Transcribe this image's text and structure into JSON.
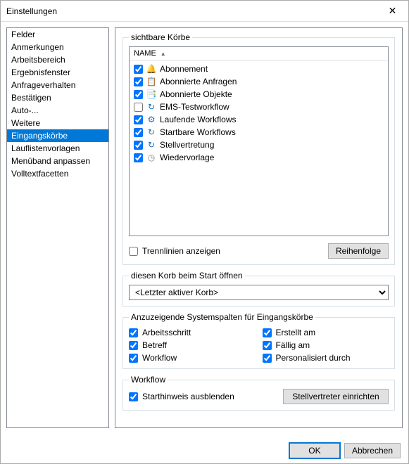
{
  "window": {
    "title": "Einstellungen"
  },
  "sidebar": {
    "items": [
      {
        "label": "Felder"
      },
      {
        "label": "Anmerkungen"
      },
      {
        "label": "Arbeitsbereich"
      },
      {
        "label": "Ergebnisfenster"
      },
      {
        "label": "Anfrageverhalten"
      },
      {
        "label": "Bestätigen"
      },
      {
        "label": "Auto-..."
      },
      {
        "label": "Weitere"
      },
      {
        "label": "Eingangskörbe"
      },
      {
        "label": "Lauflistenvorlagen"
      },
      {
        "label": "Menüband anpassen"
      },
      {
        "label": "Volltextfacetten"
      }
    ],
    "selectedIndex": 8
  },
  "visible_baskets": {
    "legend": "sichtbare Körbe",
    "header": "NAME",
    "items": [
      {
        "checked": true,
        "iconName": "bell-icon",
        "iconGlyph": "🔔",
        "iconColor": "#e6a817",
        "label": "Abonnement"
      },
      {
        "checked": true,
        "iconName": "subscribed-requests-icon",
        "iconGlyph": "📋",
        "iconColor": "#1e6fbf",
        "label": "Abonnierte Anfragen"
      },
      {
        "checked": true,
        "iconName": "subscribed-objects-icon",
        "iconGlyph": "📑",
        "iconColor": "#1e6fbf",
        "label": "Abonnierte Objekte"
      },
      {
        "checked": false,
        "iconName": "test-workflow-icon",
        "iconGlyph": "↻",
        "iconColor": "#1e6fbf",
        "label": "EMS-Testworkflow"
      },
      {
        "checked": true,
        "iconName": "running-workflows-icon",
        "iconGlyph": "⚙",
        "iconColor": "#1e6fbf",
        "label": "Laufende Workflows"
      },
      {
        "checked": true,
        "iconName": "startable-workflows-icon",
        "iconGlyph": "↻",
        "iconColor": "#1e6fbf",
        "label": "Startbare Workflows"
      },
      {
        "checked": true,
        "iconName": "delegation-icon",
        "iconGlyph": "↻",
        "iconColor": "#1e6fbf",
        "label": "Stellvertretung"
      },
      {
        "checked": true,
        "iconName": "resubmission-icon",
        "iconGlyph": "◷",
        "iconColor": "#888",
        "label": "Wiedervorlage"
      }
    ],
    "separators_label": "Trennlinien anzeigen",
    "separators_checked": false,
    "order_button": "Reihenfolge"
  },
  "open_on_start": {
    "legend": "diesen Korb beim Start öffnen",
    "selected": "<Letzter aktiver Korb>"
  },
  "system_columns": {
    "legend": "Anzuzeigende Systemspalten für Eingangskörbe",
    "items": [
      {
        "label": "Arbeitsschritt",
        "checked": true
      },
      {
        "label": "Erstellt am",
        "checked": true
      },
      {
        "label": "Betreff",
        "checked": true
      },
      {
        "label": "Fällig am",
        "checked": true
      },
      {
        "label": "Workflow",
        "checked": true
      },
      {
        "label": "Personalisiert durch",
        "checked": true
      }
    ]
  },
  "workflow": {
    "legend": "Workflow",
    "hide_hint_label": "Starthinweis ausblenden",
    "hide_hint_checked": true,
    "delegate_button": "Stellvertreter einrichten"
  },
  "footer": {
    "ok": "OK",
    "cancel": "Abbrechen"
  }
}
